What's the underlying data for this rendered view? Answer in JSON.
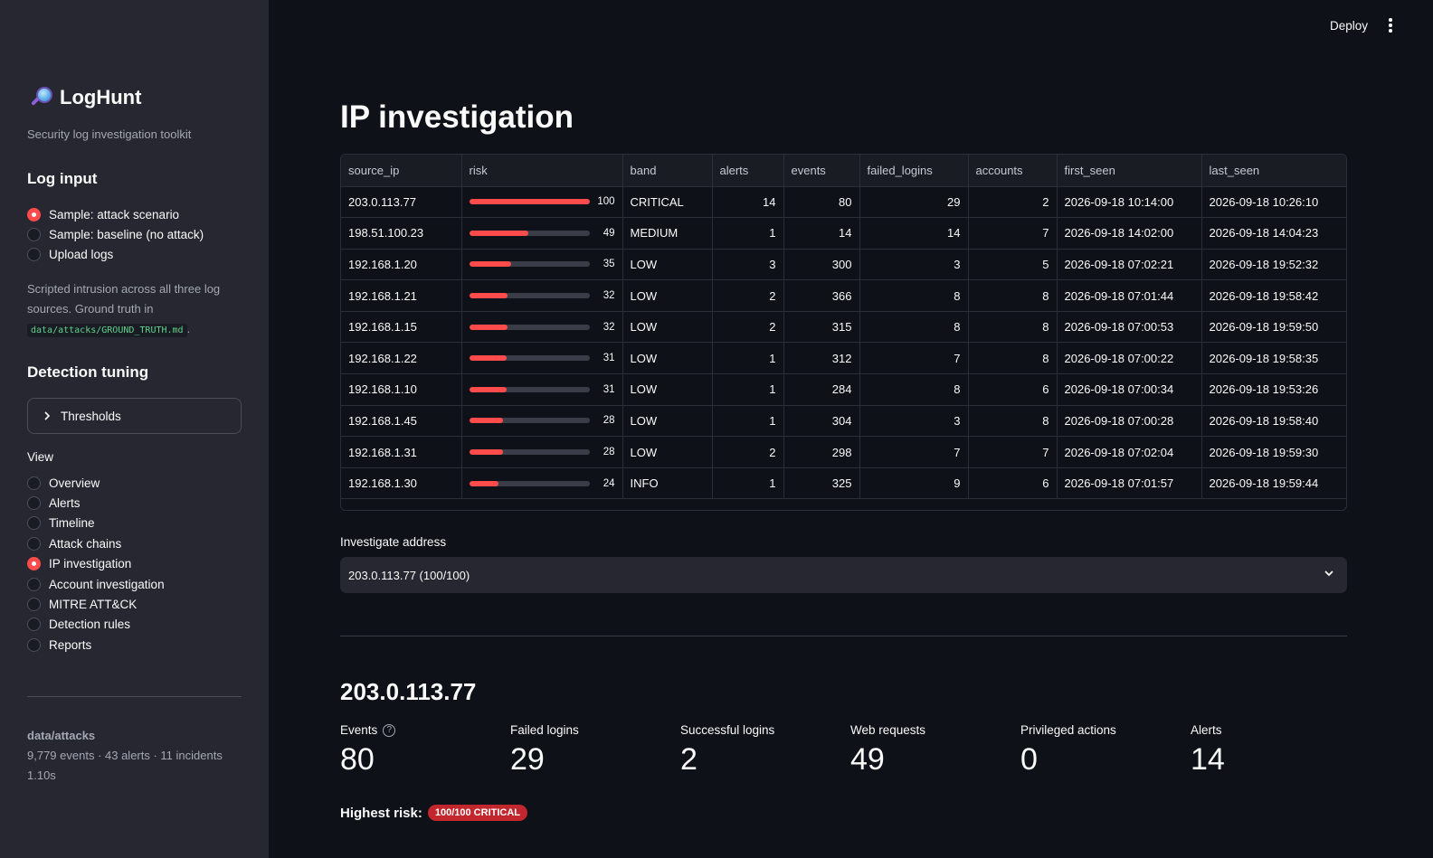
{
  "app": {
    "title": "LogHunt",
    "tagline": "Security log investigation toolkit",
    "deploy_label": "Deploy",
    "icon": "magnifying-glass-icon"
  },
  "sidebar": {
    "log_input_heading": "Log input",
    "log_input_options": [
      {
        "label": "Sample: attack scenario",
        "selected": true
      },
      {
        "label": "Sample: baseline (no attack)",
        "selected": false
      },
      {
        "label": "Upload logs",
        "selected": false
      }
    ],
    "description_text": "Scripted intrusion across all three log sources. Ground truth in ",
    "description_code": "data/attacks/GROUND_TRUTH.md",
    "description_suffix": ".",
    "tuning_heading": "Detection tuning",
    "thresholds_label": "Thresholds",
    "view_label": "View",
    "view_options": [
      {
        "label": "Overview",
        "selected": false
      },
      {
        "label": "Alerts",
        "selected": false
      },
      {
        "label": "Timeline",
        "selected": false
      },
      {
        "label": "Attack chains",
        "selected": false
      },
      {
        "label": "IP investigation",
        "selected": true
      },
      {
        "label": "Account investigation",
        "selected": false
      },
      {
        "label": "MITRE ATT&CK",
        "selected": false
      },
      {
        "label": "Detection rules",
        "selected": false
      },
      {
        "label": "Reports",
        "selected": false
      }
    ],
    "footer": {
      "source": "data/attacks",
      "stats": "9,779 events · 43 alerts · 11 incidents",
      "time": "1.10s"
    }
  },
  "main": {
    "title": "IP investigation",
    "table": {
      "columns": [
        "source_ip",
        "risk",
        "band",
        "alerts",
        "events",
        "failed_logins",
        "accounts",
        "first_seen",
        "last_seen"
      ],
      "rows": [
        {
          "source_ip": "203.0.113.77",
          "risk": 100,
          "band": "CRITICAL",
          "alerts": 14,
          "events": 80,
          "failed_logins": 29,
          "accounts": 2,
          "first_seen": "2026-09-18 10:14:00",
          "last_seen": "2026-09-18 10:26:10"
        },
        {
          "source_ip": "198.51.100.23",
          "risk": 49,
          "band": "MEDIUM",
          "alerts": 1,
          "events": 14,
          "failed_logins": 14,
          "accounts": 7,
          "first_seen": "2026-09-18 14:02:00",
          "last_seen": "2026-09-18 14:04:23"
        },
        {
          "source_ip": "192.168.1.20",
          "risk": 35,
          "band": "LOW",
          "alerts": 3,
          "events": 300,
          "failed_logins": 3,
          "accounts": 5,
          "first_seen": "2026-09-18 07:02:21",
          "last_seen": "2026-09-18 19:52:32"
        },
        {
          "source_ip": "192.168.1.21",
          "risk": 32,
          "band": "LOW",
          "alerts": 2,
          "events": 366,
          "failed_logins": 8,
          "accounts": 8,
          "first_seen": "2026-09-18 07:01:44",
          "last_seen": "2026-09-18 19:58:42"
        },
        {
          "source_ip": "192.168.1.15",
          "risk": 32,
          "band": "LOW",
          "alerts": 2,
          "events": 315,
          "failed_logins": 8,
          "accounts": 8,
          "first_seen": "2026-09-18 07:00:53",
          "last_seen": "2026-09-18 19:59:50"
        },
        {
          "source_ip": "192.168.1.22",
          "risk": 31,
          "band": "LOW",
          "alerts": 1,
          "events": 312,
          "failed_logins": 7,
          "accounts": 8,
          "first_seen": "2026-09-18 07:00:22",
          "last_seen": "2026-09-18 19:58:35"
        },
        {
          "source_ip": "192.168.1.10",
          "risk": 31,
          "band": "LOW",
          "alerts": 1,
          "events": 284,
          "failed_logins": 8,
          "accounts": 6,
          "first_seen": "2026-09-18 07:00:34",
          "last_seen": "2026-09-18 19:53:26"
        },
        {
          "source_ip": "192.168.1.45",
          "risk": 28,
          "band": "LOW",
          "alerts": 1,
          "events": 304,
          "failed_logins": 3,
          "accounts": 8,
          "first_seen": "2026-09-18 07:00:28",
          "last_seen": "2026-09-18 19:58:40"
        },
        {
          "source_ip": "192.168.1.31",
          "risk": 28,
          "band": "LOW",
          "alerts": 2,
          "events": 298,
          "failed_logins": 7,
          "accounts": 7,
          "first_seen": "2026-09-18 07:02:04",
          "last_seen": "2026-09-18 19:59:30"
        },
        {
          "source_ip": "192.168.1.30",
          "risk": 24,
          "band": "INFO",
          "alerts": 1,
          "events": 325,
          "failed_logins": 9,
          "accounts": 6,
          "first_seen": "2026-09-18 07:01:57",
          "last_seen": "2026-09-18 19:59:44"
        }
      ]
    },
    "investigate_label": "Investigate address",
    "investigate_value": "203.0.113.77  (100/100)",
    "selected_ip": "203.0.113.77",
    "metrics": [
      {
        "label": "Events",
        "value": "80",
        "help": true
      },
      {
        "label": "Failed logins",
        "value": "29"
      },
      {
        "label": "Successful logins",
        "value": "2"
      },
      {
        "label": "Web requests",
        "value": "49"
      },
      {
        "label": "Privileged actions",
        "value": "0"
      },
      {
        "label": "Alerts",
        "value": "14"
      }
    ],
    "highest_risk_label": "Highest risk:",
    "highest_risk_badge": "100/100 CRITICAL",
    "colors": {
      "accent": "#ff4b4b",
      "badge": "#c1272d",
      "sidebar_bg": "#262730",
      "main_bg": "#0e1117"
    }
  }
}
